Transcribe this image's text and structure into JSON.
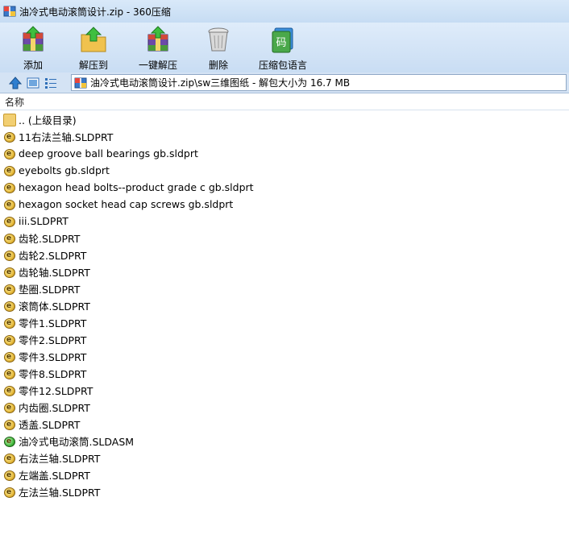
{
  "window": {
    "title": "油冷式电动滚筒设计.zip - 360压缩",
    "app_icon": "archive-app-icon"
  },
  "toolbar": {
    "buttons": [
      {
        "label": "添加",
        "icon": "add-archive-icon"
      },
      {
        "label": "解压到",
        "icon": "extract-to-icon"
      },
      {
        "label": "一键解压",
        "icon": "one-click-extract-icon"
      },
      {
        "label": "删除",
        "icon": "delete-trash-icon"
      },
      {
        "label": "压缩包语言",
        "icon": "archive-language-icon"
      }
    ]
  },
  "navigation": {
    "address": "油冷式电动滚筒设计.zip\\sw三维图纸 - 解包大小为 16.7 MB"
  },
  "list": {
    "column_header": "名称",
    "items": [
      {
        "name": ".. (上级目录)",
        "type": "folder"
      },
      {
        "name": "11右法兰轴.SLDPRT",
        "type": "part"
      },
      {
        "name": "deep groove ball bearings gb.sldprt",
        "type": "part"
      },
      {
        "name": "eyebolts gb.sldprt",
        "type": "part"
      },
      {
        "name": "hexagon head bolts--product grade c gb.sldprt",
        "type": "part"
      },
      {
        "name": "hexagon socket head cap screws gb.sldprt",
        "type": "part"
      },
      {
        "name": "iii.SLDPRT",
        "type": "part"
      },
      {
        "name": "齿轮.SLDPRT",
        "type": "part"
      },
      {
        "name": "齿轮2.SLDPRT",
        "type": "part"
      },
      {
        "name": "齿轮轴.SLDPRT",
        "type": "part"
      },
      {
        "name": "垫圈.SLDPRT",
        "type": "part"
      },
      {
        "name": "滚筒体.SLDPRT",
        "type": "part"
      },
      {
        "name": "零件1.SLDPRT",
        "type": "part"
      },
      {
        "name": "零件2.SLDPRT",
        "type": "part"
      },
      {
        "name": "零件3.SLDPRT",
        "type": "part"
      },
      {
        "name": "零件8.SLDPRT",
        "type": "part"
      },
      {
        "name": "零件12.SLDPRT",
        "type": "part"
      },
      {
        "name": "内齿圈.SLDPRT",
        "type": "part"
      },
      {
        "name": "透盖.SLDPRT",
        "type": "part"
      },
      {
        "name": "油冷式电动滚筒.SLDASM",
        "type": "assembly"
      },
      {
        "name": "右法兰轴.SLDPRT",
        "type": "part"
      },
      {
        "name": "左端盖.SLDPRT",
        "type": "part"
      },
      {
        "name": "左法兰轴.SLDPRT",
        "type": "part"
      }
    ]
  }
}
